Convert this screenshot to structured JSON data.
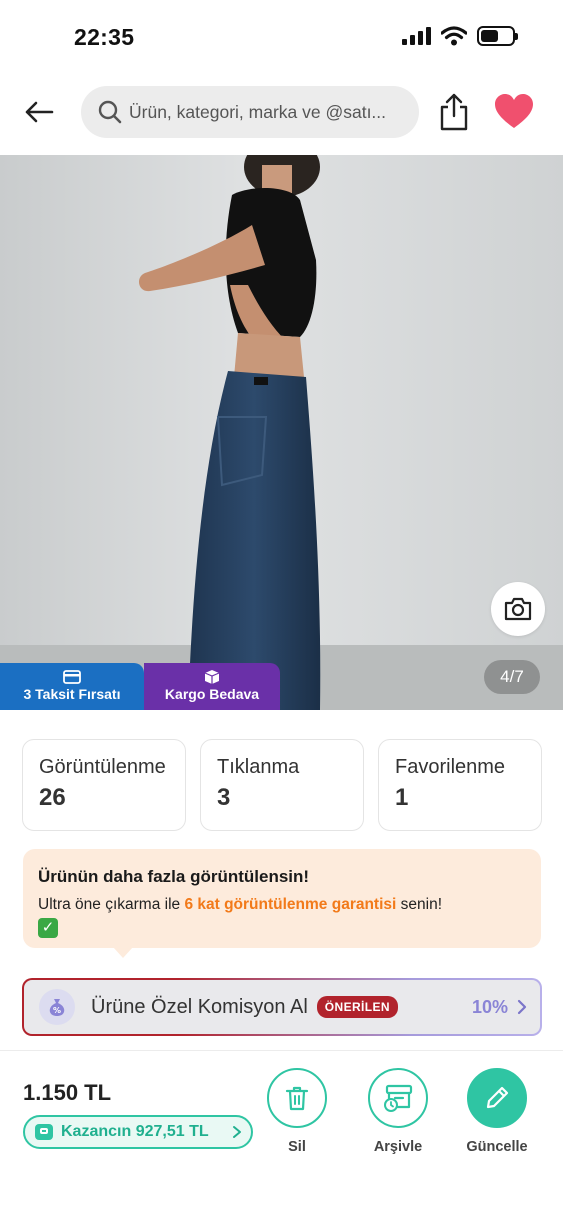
{
  "status_bar": {
    "time": "22:35"
  },
  "header": {
    "search_placeholder": "Ürün, kategori, marka ve @satı..."
  },
  "product_image": {
    "page_indicator": "4/7",
    "badges": [
      {
        "label": "3 Taksit Fırsatı",
        "color": "#1b6fc2"
      },
      {
        "label": "Kargo Bedava",
        "color": "#6a30a8"
      }
    ]
  },
  "stats": [
    {
      "label": "Görüntülenme",
      "value": "26"
    },
    {
      "label": "Tıklanma",
      "value": "3"
    },
    {
      "label": "Favorilenme",
      "value": "1"
    }
  ],
  "promo": {
    "title": "Ürünün daha fazla görüntülensin!",
    "text_before": "Ultra öne çıkarma ile ",
    "highlight": "6 kat görüntülenme garantisi",
    "text_after": " senin!",
    "emoji": "✅"
  },
  "commission": {
    "label": "Ürüne Özel Komisyon Al",
    "badge": "ÖNERİLEN",
    "rate": "10%"
  },
  "bottom_bar": {
    "price": "1.150 TL",
    "earnings": "Kazancın 927,51 TL",
    "actions": [
      {
        "label": "Sil",
        "icon": "trash-icon"
      },
      {
        "label": "Arşivle",
        "icon": "archive-icon"
      },
      {
        "label": "Güncelle",
        "icon": "pencil-icon"
      }
    ]
  },
  "colors": {
    "accent_green": "#2fc5a3",
    "promo_orange": "#f27a1a",
    "badge_red": "#b1232c",
    "heart_pink": "#f0506e"
  }
}
